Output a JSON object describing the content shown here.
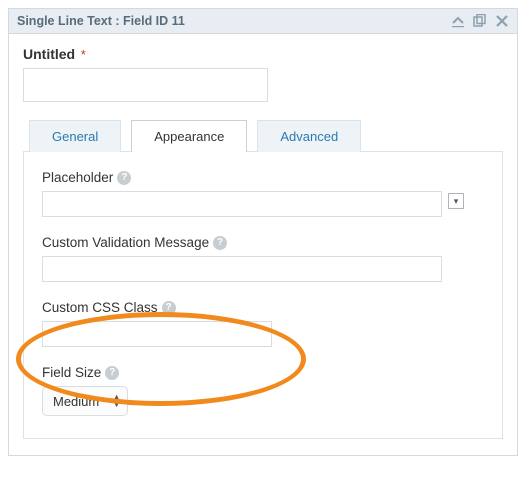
{
  "header": {
    "title": "Single Line Text : Field ID 11"
  },
  "field": {
    "label": "Untitled",
    "required_marker": "*",
    "value": ""
  },
  "tabs": {
    "general": "General",
    "appearance": "Appearance",
    "advanced": "Advanced",
    "active": "appearance"
  },
  "appearance": {
    "placeholder": {
      "label": "Placeholder",
      "value": ""
    },
    "custom_validation": {
      "label": "Custom Validation Message",
      "value": ""
    },
    "custom_css": {
      "label": "Custom CSS Class",
      "value": ""
    },
    "field_size": {
      "label": "Field Size",
      "value": "Medium"
    }
  },
  "icons": {
    "collapse": "collapse-icon",
    "duplicate": "duplicate-icon",
    "delete": "close-icon"
  }
}
